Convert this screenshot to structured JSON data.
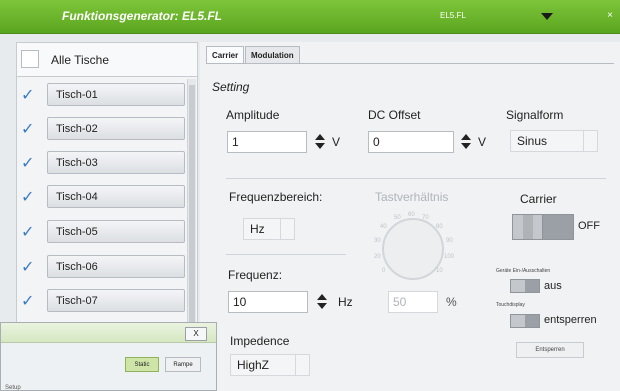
{
  "window": {
    "title": "Funktionsgenerator: EL5.FL",
    "selected_device": "EL5.FL",
    "close_label": "×"
  },
  "tables": {
    "all_label": "Alle Tische",
    "items": [
      {
        "label": "Tisch-01",
        "checked": true
      },
      {
        "label": "Tisch-02",
        "checked": true
      },
      {
        "label": "Tisch-03",
        "checked": true
      },
      {
        "label": "Tisch-04",
        "checked": true
      },
      {
        "label": "Tisch-05",
        "checked": true
      },
      {
        "label": "Tisch-06",
        "checked": true
      },
      {
        "label": "Tisch-07",
        "checked": true
      }
    ],
    "check_glyph": "✓"
  },
  "tabs": {
    "carrier": "Carrier",
    "modulation": "Modulation"
  },
  "setting": {
    "heading": "Setting",
    "amplitude_label": "Amplitude",
    "amplitude_value": "1",
    "amplitude_unit": "V",
    "offset_label": "DC Offset",
    "offset_value": "0",
    "offset_unit": "V",
    "signal_label": "Signalform",
    "signal_value": "Sinus",
    "range_label": "Frequenzbereich:",
    "range_value": "Hz",
    "duty_label": "Tastverhältnis",
    "duty_value": "50",
    "duty_unit": "%",
    "carrier_label": "Carrier",
    "carrier_state": "OFF",
    "freq_label": "Frequenz:",
    "freq_value": "10",
    "freq_unit": "Hz",
    "impedance_label": "Impedence",
    "impedance_value": "HighZ",
    "power_label": "Geräte Ein-/Ausschalten",
    "power_state": "aus",
    "touch_label": "Touchdisplay",
    "touch_state": "entsperren",
    "small_button_label": "Entsperren"
  },
  "knob": {
    "ticks": [
      "60",
      "70",
      "50",
      "40",
      "80",
      "30",
      "90",
      "20",
      "100",
      "0",
      "10"
    ]
  },
  "popup": {
    "close_label": "X",
    "static_label": "Static",
    "rampe_label": "Rampe",
    "bottom_label": "Setup"
  },
  "colors": {
    "title_bar": "#6fb82d",
    "check": "#3a7cc4",
    "static_active": "#cfe5a8"
  }
}
